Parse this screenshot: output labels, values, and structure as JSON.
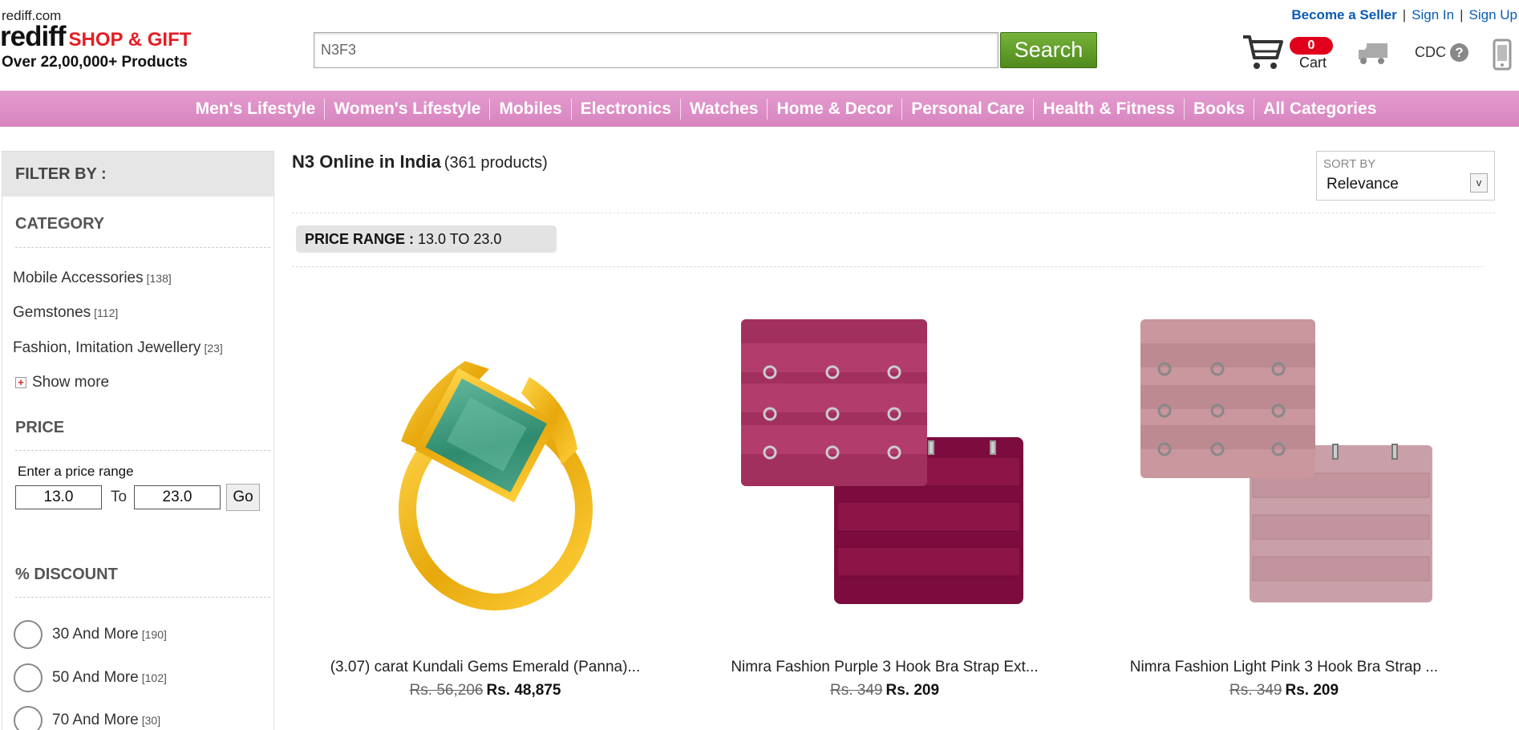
{
  "header": {
    "domain": "rediff.com",
    "logo_main": "rediff",
    "logo_sub": "SHOP & GIFT",
    "tagline": "Over 22,00,000+ Products",
    "search_value": "N3F3",
    "search_button": "Search",
    "links": {
      "seller": "Become a Seller",
      "sep": "|",
      "signin": "Sign In",
      "signup": "Sign Up"
    },
    "cart_count": "0",
    "cart_label": "Cart",
    "cdc_label": "CDC",
    "help_glyph": "?"
  },
  "nav": {
    "items": [
      "Men's Lifestyle",
      "Women's Lifestyle",
      "Mobiles",
      "Electronics",
      "Watches",
      "Home & Decor",
      "Personal Care",
      "Health & Fitness",
      "Books",
      "All Categories"
    ]
  },
  "sidebar": {
    "filter_title": "FILTER BY :",
    "category_title": "CATEGORY",
    "categories": [
      {
        "label": "Mobile Accessories",
        "count": "[138]"
      },
      {
        "label": "Gemstones",
        "count": "[112]"
      },
      {
        "label": "Fashion, Imitation Jewellery",
        "count": "[23]"
      }
    ],
    "show_more": "Show more",
    "show_more_glyph": "+",
    "price_title": "PRICE",
    "price_hint": "Enter a price range",
    "price_min": "13.0",
    "price_to": "To",
    "price_max": "23.0",
    "go_label": "Go",
    "discount_title": "% DISCOUNT",
    "discounts": [
      {
        "label": "30 And More",
        "count": "[190]"
      },
      {
        "label": "50 And More",
        "count": "[102]"
      },
      {
        "label": "70 And More",
        "count": "[30]"
      }
    ]
  },
  "main": {
    "title": "N3 Online in India",
    "count": "(361 products)",
    "sort_label": "SORT BY",
    "sort_value": "Relevance",
    "sort_chevron": "v",
    "price_chip_label": "PRICE RANGE :",
    "price_chip_value": "13.0 TO 23.0",
    "products": [
      {
        "name": "(3.07) carat Kundali Gems Emerald (Panna)...",
        "old_price": "Rs. 56,206",
        "new_price": "Rs. 48,875"
      },
      {
        "name": "Nimra Fashion Purple 3 Hook Bra Strap Ext...",
        "old_price": "Rs. 349",
        "new_price": "Rs. 209"
      },
      {
        "name": "Nimra Fashion Light Pink 3 Hook Bra Strap ...",
        "old_price": "Rs. 349",
        "new_price": "Rs. 209"
      }
    ]
  },
  "icons": {
    "cart": "cart-icon",
    "truck": "truck-icon",
    "help": "help-icon",
    "phone": "phone-icon",
    "plus": "plus-icon",
    "chevron": "chevron-down-icon"
  },
  "colors": {
    "nav_bg": "#dc8cc5",
    "search_btn": "#5f9b26",
    "cart_badge": "#e0001b",
    "logo_accent": "#e31e24",
    "link": "#0a5cb3"
  }
}
